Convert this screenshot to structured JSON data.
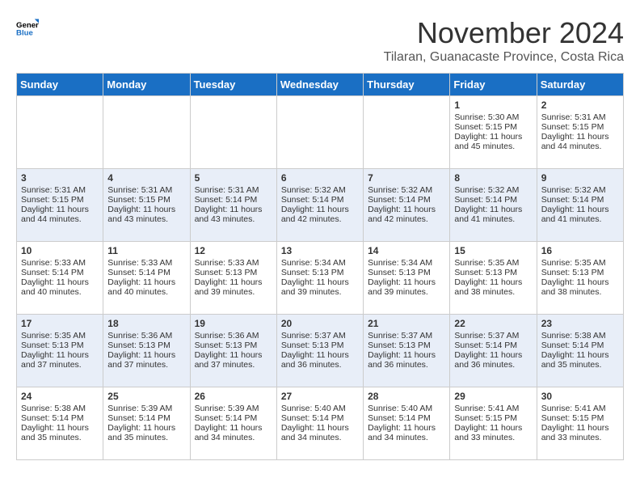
{
  "header": {
    "logo_line1": "General",
    "logo_line2": "Blue",
    "month": "November 2024",
    "location": "Tilaran, Guanacaste Province, Costa Rica"
  },
  "weekdays": [
    "Sunday",
    "Monday",
    "Tuesday",
    "Wednesday",
    "Thursday",
    "Friday",
    "Saturday"
  ],
  "weeks": [
    [
      {
        "day": "",
        "info": ""
      },
      {
        "day": "",
        "info": ""
      },
      {
        "day": "",
        "info": ""
      },
      {
        "day": "",
        "info": ""
      },
      {
        "day": "",
        "info": ""
      },
      {
        "day": "1",
        "info": "Sunrise: 5:30 AM\nSunset: 5:15 PM\nDaylight: 11 hours and 45 minutes."
      },
      {
        "day": "2",
        "info": "Sunrise: 5:31 AM\nSunset: 5:15 PM\nDaylight: 11 hours and 44 minutes."
      }
    ],
    [
      {
        "day": "3",
        "info": "Sunrise: 5:31 AM\nSunset: 5:15 PM\nDaylight: 11 hours and 44 minutes."
      },
      {
        "day": "4",
        "info": "Sunrise: 5:31 AM\nSunset: 5:15 PM\nDaylight: 11 hours and 43 minutes."
      },
      {
        "day": "5",
        "info": "Sunrise: 5:31 AM\nSunset: 5:14 PM\nDaylight: 11 hours and 43 minutes."
      },
      {
        "day": "6",
        "info": "Sunrise: 5:32 AM\nSunset: 5:14 PM\nDaylight: 11 hours and 42 minutes."
      },
      {
        "day": "7",
        "info": "Sunrise: 5:32 AM\nSunset: 5:14 PM\nDaylight: 11 hours and 42 minutes."
      },
      {
        "day": "8",
        "info": "Sunrise: 5:32 AM\nSunset: 5:14 PM\nDaylight: 11 hours and 41 minutes."
      },
      {
        "day": "9",
        "info": "Sunrise: 5:32 AM\nSunset: 5:14 PM\nDaylight: 11 hours and 41 minutes."
      }
    ],
    [
      {
        "day": "10",
        "info": "Sunrise: 5:33 AM\nSunset: 5:14 PM\nDaylight: 11 hours and 40 minutes."
      },
      {
        "day": "11",
        "info": "Sunrise: 5:33 AM\nSunset: 5:14 PM\nDaylight: 11 hours and 40 minutes."
      },
      {
        "day": "12",
        "info": "Sunrise: 5:33 AM\nSunset: 5:13 PM\nDaylight: 11 hours and 39 minutes."
      },
      {
        "day": "13",
        "info": "Sunrise: 5:34 AM\nSunset: 5:13 PM\nDaylight: 11 hours and 39 minutes."
      },
      {
        "day": "14",
        "info": "Sunrise: 5:34 AM\nSunset: 5:13 PM\nDaylight: 11 hours and 39 minutes."
      },
      {
        "day": "15",
        "info": "Sunrise: 5:35 AM\nSunset: 5:13 PM\nDaylight: 11 hours and 38 minutes."
      },
      {
        "day": "16",
        "info": "Sunrise: 5:35 AM\nSunset: 5:13 PM\nDaylight: 11 hours and 38 minutes."
      }
    ],
    [
      {
        "day": "17",
        "info": "Sunrise: 5:35 AM\nSunset: 5:13 PM\nDaylight: 11 hours and 37 minutes."
      },
      {
        "day": "18",
        "info": "Sunrise: 5:36 AM\nSunset: 5:13 PM\nDaylight: 11 hours and 37 minutes."
      },
      {
        "day": "19",
        "info": "Sunrise: 5:36 AM\nSunset: 5:13 PM\nDaylight: 11 hours and 37 minutes."
      },
      {
        "day": "20",
        "info": "Sunrise: 5:37 AM\nSunset: 5:13 PM\nDaylight: 11 hours and 36 minutes."
      },
      {
        "day": "21",
        "info": "Sunrise: 5:37 AM\nSunset: 5:13 PM\nDaylight: 11 hours and 36 minutes."
      },
      {
        "day": "22",
        "info": "Sunrise: 5:37 AM\nSunset: 5:14 PM\nDaylight: 11 hours and 36 minutes."
      },
      {
        "day": "23",
        "info": "Sunrise: 5:38 AM\nSunset: 5:14 PM\nDaylight: 11 hours and 35 minutes."
      }
    ],
    [
      {
        "day": "24",
        "info": "Sunrise: 5:38 AM\nSunset: 5:14 PM\nDaylight: 11 hours and 35 minutes."
      },
      {
        "day": "25",
        "info": "Sunrise: 5:39 AM\nSunset: 5:14 PM\nDaylight: 11 hours and 35 minutes."
      },
      {
        "day": "26",
        "info": "Sunrise: 5:39 AM\nSunset: 5:14 PM\nDaylight: 11 hours and 34 minutes."
      },
      {
        "day": "27",
        "info": "Sunrise: 5:40 AM\nSunset: 5:14 PM\nDaylight: 11 hours and 34 minutes."
      },
      {
        "day": "28",
        "info": "Sunrise: 5:40 AM\nSunset: 5:14 PM\nDaylight: 11 hours and 34 minutes."
      },
      {
        "day": "29",
        "info": "Sunrise: 5:41 AM\nSunset: 5:15 PM\nDaylight: 11 hours and 33 minutes."
      },
      {
        "day": "30",
        "info": "Sunrise: 5:41 AM\nSunset: 5:15 PM\nDaylight: 11 hours and 33 minutes."
      }
    ]
  ]
}
